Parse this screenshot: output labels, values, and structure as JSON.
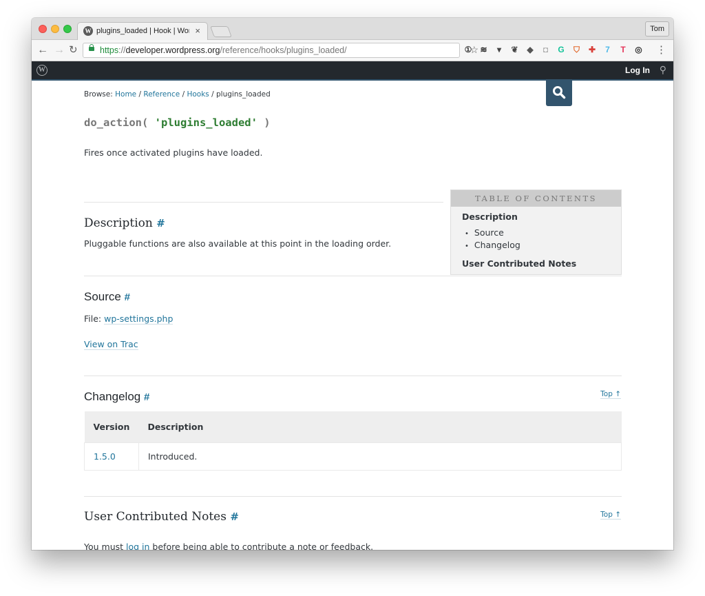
{
  "browser": {
    "tab": {
      "title": "plugins_loaded | Hook | WordPress",
      "close_icon": "×"
    },
    "profile_label": "Tom",
    "url": {
      "scheme": "https",
      "sep": "://",
      "host": "developer.wordpress.org",
      "path": "/reference/hooks/plugins_loaded/"
    },
    "extensions": [
      {
        "name": "1password-icon",
        "glyph": "①",
        "color": "#444444"
      },
      {
        "name": "buffer-icon",
        "glyph": "≋",
        "color": "#222222"
      },
      {
        "name": "pocket-icon",
        "glyph": "▾",
        "color": "#444444"
      },
      {
        "name": "evernote-icon",
        "glyph": "❦",
        "color": "#444444"
      },
      {
        "name": "stack-icon",
        "glyph": "◆",
        "color": "#555555"
      },
      {
        "name": "camera-icon",
        "glyph": "◘",
        "color": "#aaaaaa"
      },
      {
        "name": "grammarly-icon",
        "glyph": "G",
        "color": "#15c39a"
      },
      {
        "name": "ublock-icon",
        "glyph": "⛉",
        "color": "#e2692d"
      },
      {
        "name": "clockify-icon",
        "glyph": "✚",
        "color": "#d9403a"
      },
      {
        "name": "ghostery-icon",
        "glyph": "7",
        "color": "#4fb9e8"
      },
      {
        "name": "todoist-icon",
        "glyph": "T",
        "color": "#e5375b"
      },
      {
        "name": "vpn-icon",
        "glyph": "◎",
        "color": "#333333"
      }
    ]
  },
  "wpbar": {
    "login_label": "Log In"
  },
  "breadcrumb": {
    "prefix": "Browse:",
    "items": [
      {
        "label": "Home",
        "link": true
      },
      {
        "label": "Reference",
        "link": true
      },
      {
        "label": "Hooks",
        "link": true
      },
      {
        "label": "plugins_loaded",
        "link": false
      }
    ],
    "separator": "/"
  },
  "signature": {
    "fn": "do_action( ",
    "arg": "'plugins_loaded'",
    "close": " )"
  },
  "summary": "Fires once activated plugins have loaded.",
  "toc": {
    "title": "TABLE OF CONTENTS",
    "items": [
      {
        "label": "Description",
        "level": 1
      },
      {
        "label": "Source",
        "level": 2
      },
      {
        "label": "Changelog",
        "level": 2
      },
      {
        "label": "User Contributed Notes",
        "level": 1
      }
    ]
  },
  "description": {
    "heading": "Description",
    "anchor": "#",
    "text": "Pluggable functions are also available at this point in the loading order."
  },
  "source": {
    "heading": "Source",
    "anchor": "#",
    "file_prefix": "File:",
    "file_link": "wp-settings.php",
    "trac_link": "View on Trac"
  },
  "changelog": {
    "heading": "Changelog",
    "anchor": "#",
    "top_link": "Top ↑",
    "columns": [
      "Version",
      "Description"
    ],
    "rows": [
      {
        "version": "1.5.0",
        "description": "Introduced."
      }
    ]
  },
  "notes": {
    "heading": "User Contributed Notes",
    "anchor": "#",
    "top_link": "Top ↑",
    "text_before": "You must ",
    "link": "log in",
    "text_after": " before being able to contribute a note or feedback."
  }
}
